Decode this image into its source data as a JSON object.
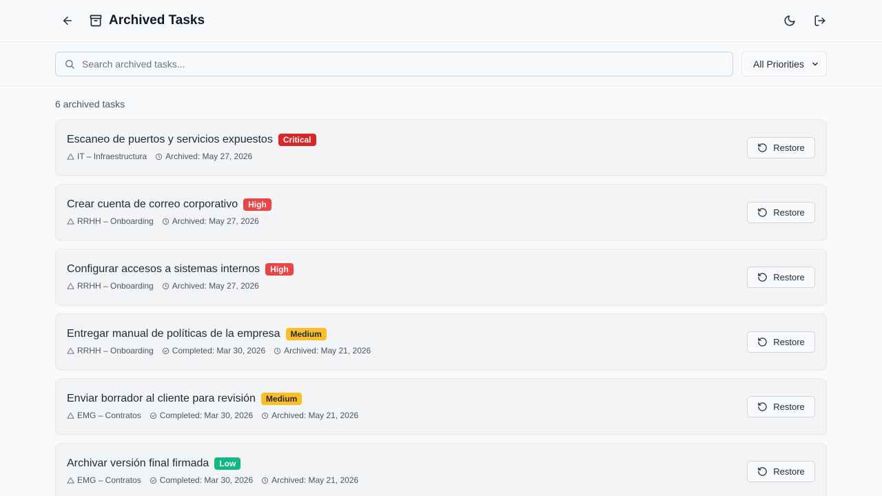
{
  "header": {
    "title": "Archived Tasks"
  },
  "toolbar": {
    "search_placeholder": "Search archived tasks...",
    "priority_selected": "All Priorities"
  },
  "count_label": "6 archived tasks",
  "restore_label": "Restore",
  "priority_colors": {
    "Critical": "#dc2626",
    "High": "#ef4444",
    "Medium": "#fbbf24",
    "Low": "#10b981"
  },
  "tasks": [
    {
      "title": "Escaneo de puertos y servicios expuestos",
      "priority": "Critical",
      "project": "IT – Infraestructura",
      "completed": "",
      "archived": "Archived: May 27, 2026"
    },
    {
      "title": "Crear cuenta de correo corporativo",
      "priority": "High",
      "project": "RRHH – Onboarding",
      "completed": "",
      "archived": "Archived: May 27, 2026"
    },
    {
      "title": "Configurar accesos a sistemas internos",
      "priority": "High",
      "project": "RRHH – Onboarding",
      "completed": "",
      "archived": "Archived: May 27, 2026"
    },
    {
      "title": "Entregar manual de políticas de la empresa",
      "priority": "Medium",
      "project": "RRHH – Onboarding",
      "completed": "Completed: Mar 30, 2026",
      "archived": "Archived: May 21, 2026"
    },
    {
      "title": "Enviar borrador al cliente para revisión",
      "priority": "Medium",
      "project": "EMG – Contratos",
      "completed": "Completed: Mar 30, 2026",
      "archived": "Archived: May 21, 2026"
    },
    {
      "title": "Archivar versión final firmada",
      "priority": "Low",
      "project": "EMG – Contratos",
      "completed": "Completed: Mar 30, 2026",
      "archived": "Archived: May 21, 2026"
    }
  ]
}
